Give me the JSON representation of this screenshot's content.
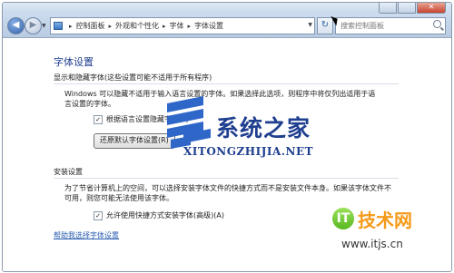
{
  "window": {
    "caption": {
      "minimize": "",
      "maximize": "",
      "close": "✕"
    }
  },
  "nav": {
    "back": "◀",
    "forward": "▶",
    "dropdown": "▼",
    "breadcrumb": [
      "控制面板",
      "外观和个性化",
      "字体",
      "字体设置"
    ],
    "separator": "▸",
    "refresh": "↻",
    "search_placeholder": "搜索控制面板"
  },
  "page": {
    "title": "字体设置",
    "section1": {
      "title": "显示和隐藏字体(这些设置可能不适用于所有程序)",
      "desc": "Windows 可以隐藏不适用于输入语言设置的字体。如果选择此选项，则程序中将仅列出适用于语言设置的字体。",
      "checkbox_label": "根据语言设置隐藏字体(L)",
      "checkbox_checked": "✓",
      "button_label": "还原默认字体设置(R)"
    },
    "section2": {
      "title": "安装设置",
      "desc": "为了节省计算机上的空间，可以选择安装字体文件的快捷方式而不是安装文件本身。如果该字体文件不可用，则您可能无法使用该字体。",
      "checkbox_label": "允许使用快捷方式安装字体(高级)(A)",
      "checkbox_checked": "✓"
    },
    "help_link": "帮助我选择字体设置"
  },
  "watermarks": {
    "main_title": "系统之家",
    "main_sub": "XITONGZHIJIA.NET",
    "second_badge": "IT",
    "second_title": "技术网",
    "second_url": "www.itjs.cn"
  }
}
